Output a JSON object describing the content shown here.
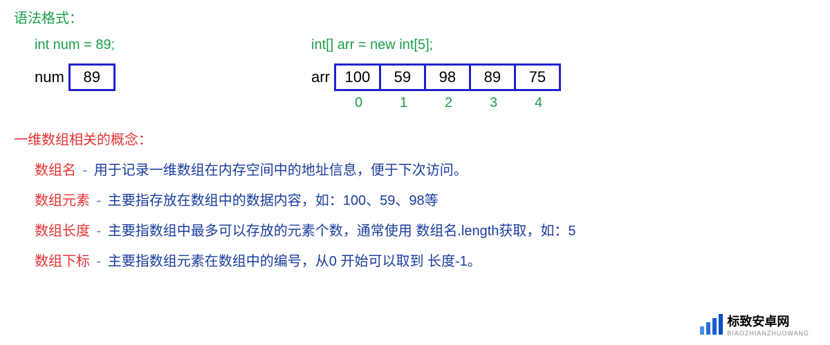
{
  "header": {
    "syntax_title": "语法格式："
  },
  "code": {
    "int_decl": "int num = 89;",
    "arr_decl": "int[] arr = new int[5];"
  },
  "variables": {
    "num_label": "num",
    "num_value": "89",
    "arr_label": "arr",
    "arr_values": [
      "100",
      "59",
      "98",
      "89",
      "75"
    ],
    "arr_indices": [
      "0",
      "1",
      "2",
      "3",
      "4"
    ]
  },
  "section2": {
    "title": "一维数组相关的概念："
  },
  "defs": {
    "name_term": "数组名",
    "name_desc": "用于记录一维数组在内存空间中的地址信息，便于下次访问。",
    "elem_term": "数组元素",
    "elem_desc": "主要指存放在数组中的数据内容，如：100、59、98等",
    "len_term": "数组长度",
    "len_desc": "主要指数组中最多可以存放的元素个数，通常使用 数组名.length获取，如：5",
    "idx_term": "数组下标",
    "idx_desc": "主要指数组元素在数组中的编号，从0 开始可以取到 长度-1。",
    "dash": " - "
  },
  "watermark": {
    "text": "标致安卓网",
    "sub": "BIAOZHIANZHUOWANG"
  }
}
